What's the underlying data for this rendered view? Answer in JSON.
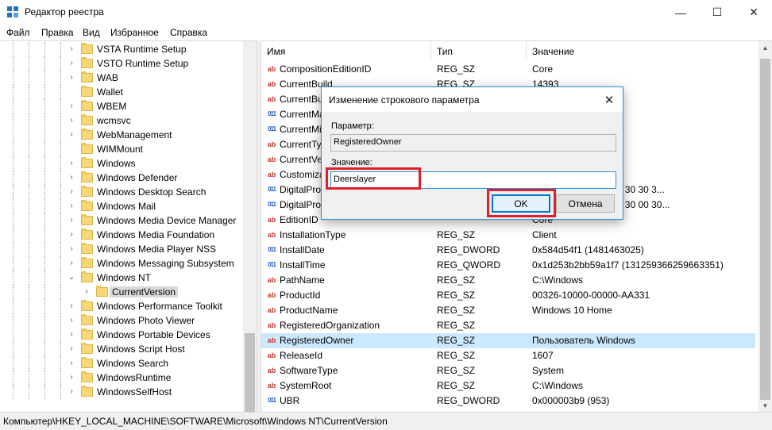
{
  "window": {
    "title": "Редактор реестра",
    "minimize": "—",
    "maximize": "☐",
    "close": "✕"
  },
  "menu": [
    "Файл",
    "Правка",
    "Вид",
    "Избранное",
    "Справка"
  ],
  "tree": [
    {
      "label": "VSTA Runtime Setup",
      "chev": ">"
    },
    {
      "label": "VSTO Runtime Setup",
      "chev": ">"
    },
    {
      "label": "WAB",
      "chev": ">"
    },
    {
      "label": "Wallet",
      "chev": ""
    },
    {
      "label": "WBEM",
      "chev": ">"
    },
    {
      "label": "wcmsvc",
      "chev": ">"
    },
    {
      "label": "WebManagement",
      "chev": ">"
    },
    {
      "label": "WIMMount",
      "chev": ""
    },
    {
      "label": "Windows",
      "chev": ">"
    },
    {
      "label": "Windows Defender",
      "chev": ">"
    },
    {
      "label": "Windows Desktop Search",
      "chev": ">"
    },
    {
      "label": "Windows Mail",
      "chev": ">"
    },
    {
      "label": "Windows Media Device Manager",
      "chev": ">"
    },
    {
      "label": "Windows Media Foundation",
      "chev": ">"
    },
    {
      "label": "Windows Media Player NSS",
      "chev": ">"
    },
    {
      "label": "Windows Messaging Subsystem",
      "chev": ">"
    },
    {
      "label": "Windows NT",
      "chev": "v"
    },
    {
      "label": "CurrentVersion",
      "chev": ">",
      "child": true,
      "selected": true
    },
    {
      "label": "Windows Performance Toolkit",
      "chev": ">"
    },
    {
      "label": "Windows Photo Viewer",
      "chev": ">"
    },
    {
      "label": "Windows Portable Devices",
      "chev": ">"
    },
    {
      "label": "Windows Script Host",
      "chev": ">"
    },
    {
      "label": "Windows Search",
      "chev": ">"
    },
    {
      "label": "WindowsRuntime",
      "chev": ">"
    },
    {
      "label": "WindowsSelfHost",
      "chev": ">"
    }
  ],
  "columns": {
    "name": "Имя",
    "type": "Тип",
    "value": "Значение"
  },
  "values": [
    {
      "icon": "ab",
      "name": "CompositionEditionID",
      "type": "REG_SZ",
      "value": "Core"
    },
    {
      "icon": "ab",
      "name": "CurrentBuild",
      "type": "REG_SZ",
      "value": "14393"
    },
    {
      "icon": "ab",
      "name": "CurrentBu",
      "type": "",
      "value": ""
    },
    {
      "icon": "bin",
      "name": "CurrentMa",
      "type": "",
      "value": ""
    },
    {
      "icon": "bin",
      "name": "CurrentMi",
      "type": "",
      "value": ""
    },
    {
      "icon": "ab",
      "name": "CurrentTy",
      "type": "",
      "value": ""
    },
    {
      "icon": "ab",
      "name": "CurrentVe",
      "type": "",
      "value": ""
    },
    {
      "icon": "ab",
      "name": "Customiza",
      "type": "",
      "value": ""
    },
    {
      "icon": "bin",
      "name": "DigitalPro",
      "type": "",
      "value": "30 30 33 32 36 2d 31 30 30 3..."
    },
    {
      "icon": "bin",
      "name": "DigitalPro",
      "type": "",
      "value": "00 30 00 30 00 30 00 30 00 30..."
    },
    {
      "icon": "ab",
      "name": "EditionID",
      "type": "",
      "value": "Core"
    },
    {
      "icon": "ab",
      "name": "InstallationType",
      "type": "REG_SZ",
      "value": "Client"
    },
    {
      "icon": "bin",
      "name": "InstallDate",
      "type": "REG_DWORD",
      "value": "0x584d54f1 (1481463025)"
    },
    {
      "icon": "bin",
      "name": "InstallTime",
      "type": "REG_QWORD",
      "value": "0x1d253b2bb59a1f7 (131259366259663351)"
    },
    {
      "icon": "ab",
      "name": "PathName",
      "type": "REG_SZ",
      "value": "C:\\Windows"
    },
    {
      "icon": "ab",
      "name": "ProductId",
      "type": "REG_SZ",
      "value": "00326-10000-00000-AA331"
    },
    {
      "icon": "ab",
      "name": "ProductName",
      "type": "REG_SZ",
      "value": "Windows 10 Home"
    },
    {
      "icon": "ab",
      "name": "RegisteredOrganization",
      "type": "REG_SZ",
      "value": ""
    },
    {
      "icon": "ab",
      "name": "RegisteredOwner",
      "type": "REG_SZ",
      "value": "Пользователь Windows",
      "selected": true
    },
    {
      "icon": "ab",
      "name": "ReleaseId",
      "type": "REG_SZ",
      "value": "1607"
    },
    {
      "icon": "ab",
      "name": "SoftwareType",
      "type": "REG_SZ",
      "value": "System"
    },
    {
      "icon": "ab",
      "name": "SystemRoot",
      "type": "REG_SZ",
      "value": "C:\\Windows"
    },
    {
      "icon": "bin",
      "name": "UBR",
      "type": "REG_DWORD",
      "value": "0x000003b9 (953)"
    }
  ],
  "status": "Компьютер\\HKEY_LOCAL_MACHINE\\SOFTWARE\\Microsoft\\Windows NT\\CurrentVersion",
  "dialog": {
    "title": "Изменение строкового параметра",
    "param_label": "Параметр:",
    "param_value": "RegisteredOwner",
    "value_label": "Значение:",
    "value_text": "Deerslayer",
    "ok": "OK",
    "cancel": "Отмена",
    "close": "✕"
  },
  "colors": {
    "highlight": "#e01f2a",
    "accent": "#0078d7",
    "selection": "#cce8ff"
  }
}
